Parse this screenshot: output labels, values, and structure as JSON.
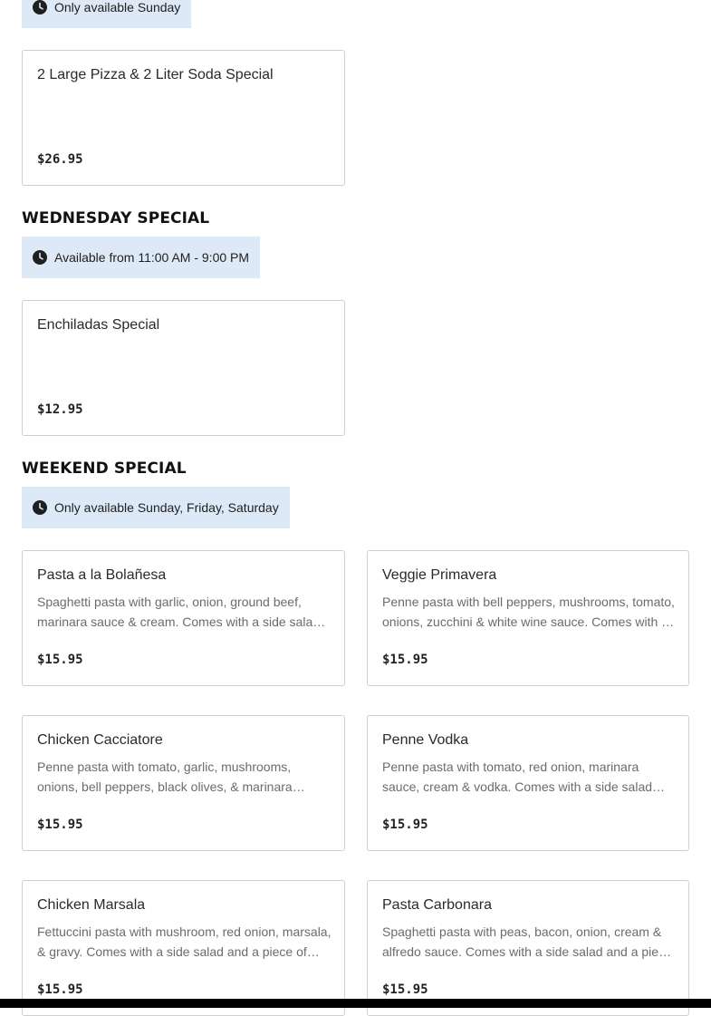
{
  "sunday_section": {
    "availability": "Only available Sunday",
    "items": [
      {
        "name": "2 Large Pizza & 2 Liter Soda Special",
        "description": "",
        "price": "$26.95"
      }
    ]
  },
  "wednesday_section": {
    "title": "WEDNESDAY SPECIAL",
    "availability": "Available from 11:00 AM - 9:00 PM",
    "items": [
      {
        "name": "Enchiladas Special",
        "description": "",
        "price": "$12.95"
      }
    ]
  },
  "weekend_section": {
    "title": "WEEKEND SPECIAL",
    "availability": "Only available Sunday, Friday, Saturday",
    "items": [
      {
        "name": "Pasta a la Bolañesa",
        "description": "Spaghetti pasta with garlic, onion, ground beef, marinara sauce & cream. Comes with a side salad and a piece of garlic bread.",
        "price": "$15.95"
      },
      {
        "name": "Veggie Primavera",
        "description": "Penne pasta with bell peppers, mushrooms, tomato, onions, zucchini & white wine sauce. Comes with a side salad and a piece of garlic bread.",
        "price": "$15.95"
      },
      {
        "name": "Chicken Cacciatore",
        "description": "Penne pasta with tomato, garlic, mushrooms, onions, bell peppers, black olives, & marinara sauce. Comes with a side salad and a piece of garlic bread.",
        "price": "$15.95"
      },
      {
        "name": "Penne Vodka",
        "description": "Penne pasta with tomato, red onion, marinara sauce, cream & vodka. Comes with a side salad and a piece of garlic bread.",
        "price": "$15.95"
      },
      {
        "name": "Chicken Marsala",
        "description": "Fettuccini pasta with mushroom, red onion, marsala, & gravy. Comes with a side salad and a piece of garlic bread.",
        "price": "$15.95"
      },
      {
        "name": "Pasta Carbonara",
        "description": "Spaghetti pasta with peas, bacon, onion, cream & alfredo sauce. Comes with a side salad and a piece of garlic bread.",
        "price": "$15.95"
      }
    ]
  },
  "icons": {
    "availability": "clock-icon"
  },
  "colors": {
    "availability_bg": "#dde9f7",
    "card_border": "#cfcfcf",
    "description_text": "#6b6b6b"
  }
}
